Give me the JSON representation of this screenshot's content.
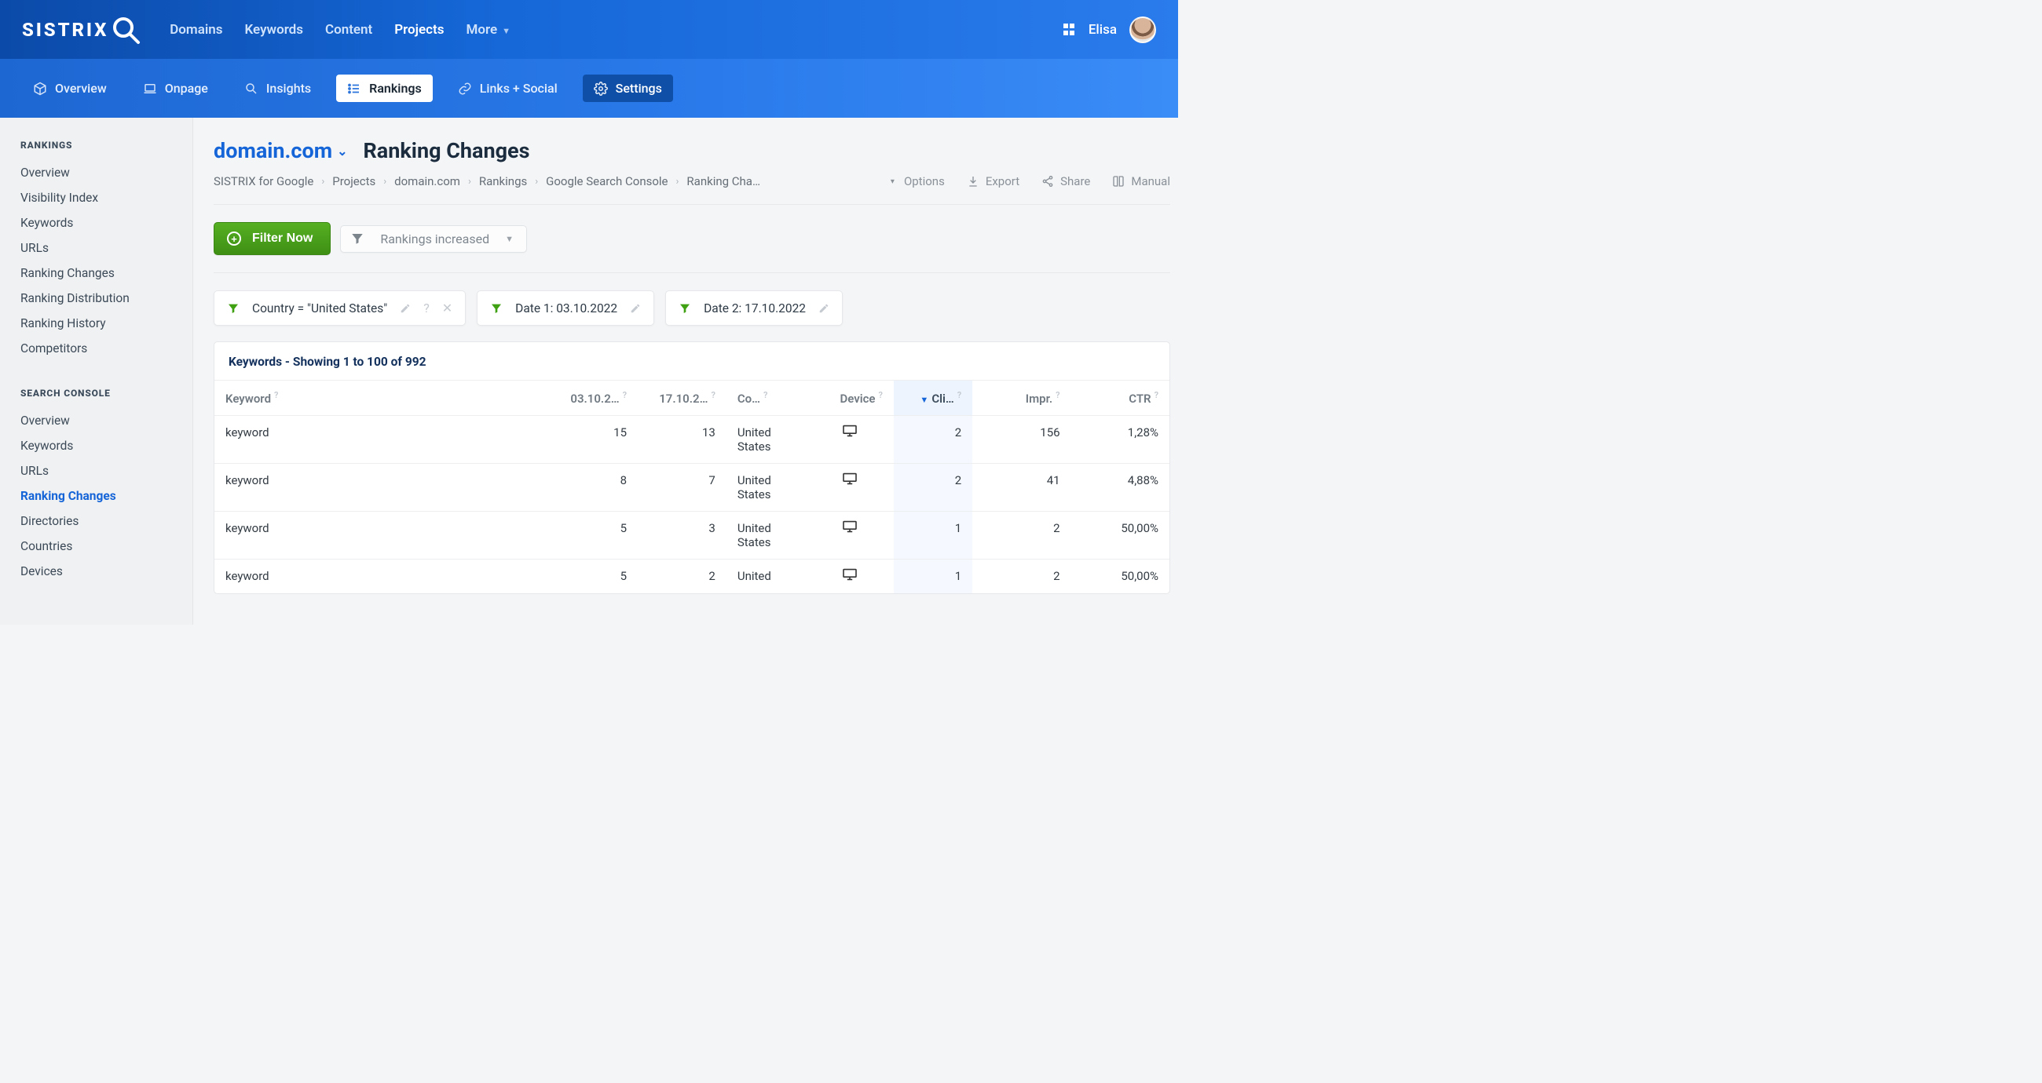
{
  "brand": "SISTRIX",
  "topnav": {
    "items": [
      {
        "label": "Domains"
      },
      {
        "label": "Keywords"
      },
      {
        "label": "Content"
      },
      {
        "label": "Projects",
        "active": true
      },
      {
        "label": "More",
        "dropdown": true
      }
    ]
  },
  "user": {
    "name": "Elisa"
  },
  "subtabs": [
    {
      "key": "overview",
      "label": "Overview",
      "icon": "cube-icon"
    },
    {
      "key": "onpage",
      "label": "Onpage",
      "icon": "laptop-icon"
    },
    {
      "key": "insights",
      "label": "Insights",
      "icon": "search-icon"
    },
    {
      "key": "rankings",
      "label": "Rankings",
      "icon": "list-icon",
      "active": true
    },
    {
      "key": "links",
      "label": "Links + Social",
      "icon": "link-icon"
    },
    {
      "key": "settings",
      "label": "Settings",
      "icon": "gear-icon",
      "boxed": true
    }
  ],
  "sidebar": {
    "group1": {
      "heading": "RANKINGS",
      "items": [
        "Overview",
        "Visibility Index",
        "Keywords",
        "URLs",
        "Ranking Changes",
        "Ranking Distribution",
        "Ranking History",
        "Competitors"
      ]
    },
    "group2": {
      "heading": "SEARCH CONSOLE",
      "items": [
        "Overview",
        "Keywords",
        "URLs",
        "Ranking Changes",
        "Directories",
        "Countries",
        "Devices"
      ],
      "active_index": 3
    }
  },
  "header": {
    "domain": "domain.com",
    "title": "Ranking Changes"
  },
  "breadcrumb": {
    "items": [
      "SISTRIX for Google",
      "Projects",
      "domain.com",
      "Rankings",
      "Google Search Console",
      "Ranking Cha…"
    ]
  },
  "actions": {
    "options": "Options",
    "export": "Export",
    "share": "Share",
    "manual": "Manual"
  },
  "filters": {
    "button": "Filter Now",
    "dropdown": "Rankings increased"
  },
  "chips": [
    {
      "text": "Country = \"United States\"",
      "editable": true,
      "help": true,
      "closable": true
    },
    {
      "text": "Date 1: 03.10.2022",
      "editable": true
    },
    {
      "text": "Date 2: 17.10.2022",
      "editable": true
    }
  ],
  "table": {
    "title": "Keywords - Showing 1 to 100 of 992",
    "columns": {
      "keyword": "Keyword",
      "date1": "03.10.2…",
      "date2": "17.10.2…",
      "country": "Co…",
      "device": "Device",
      "clicks": "Cli…",
      "impr": "Impr.",
      "ctr": "CTR"
    },
    "rows": [
      {
        "keyword": "keyword",
        "d1": "15",
        "d2": "13",
        "country": "United States",
        "clicks": "2",
        "impr": "156",
        "ctr": "1,28%"
      },
      {
        "keyword": "keyword",
        "d1": "8",
        "d2": "7",
        "country": "United States",
        "clicks": "2",
        "impr": "41",
        "ctr": "4,88%"
      },
      {
        "keyword": "keyword",
        "d1": "5",
        "d2": "3",
        "country": "United States",
        "clicks": "1",
        "impr": "2",
        "ctr": "50,00%"
      },
      {
        "keyword": "keyword",
        "d1": "5",
        "d2": "2",
        "country": "United",
        "clicks": "1",
        "impr": "2",
        "ctr": "50,00%"
      }
    ]
  }
}
